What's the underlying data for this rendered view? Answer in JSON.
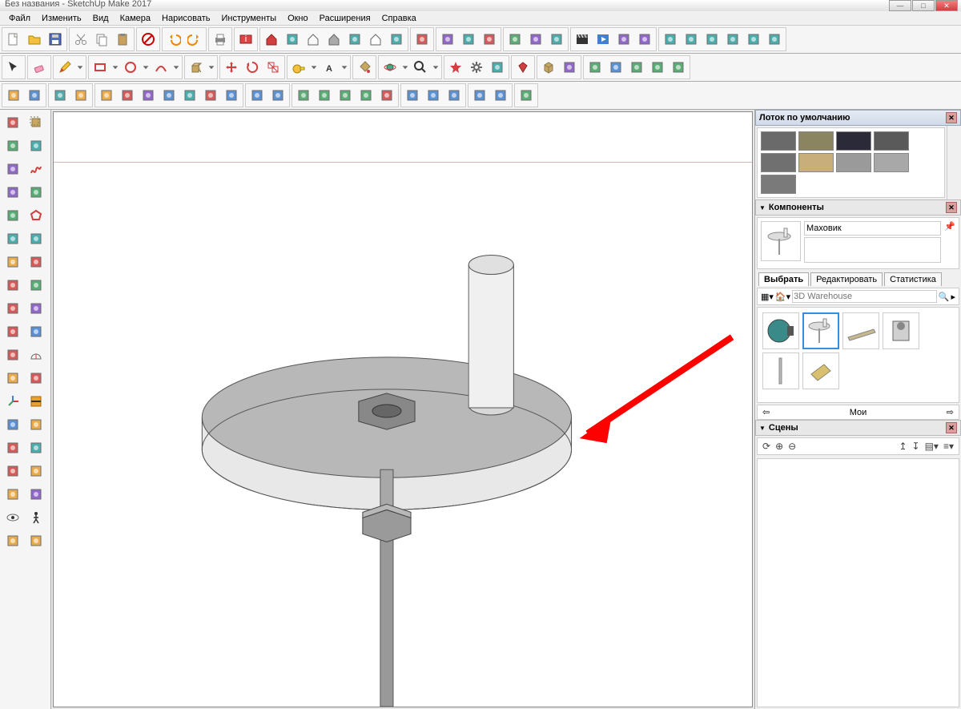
{
  "app": {
    "title": "Без названия - SketchUp Make 2017"
  },
  "menu": [
    "Файл",
    "Изменить",
    "Вид",
    "Камера",
    "Нарисовать",
    "Инструменты",
    "Окно",
    "Расширения",
    "Справка"
  ],
  "tray": {
    "title": "Лоток по умолчанию"
  },
  "materials_swatches": [
    "#6a6a6a",
    "#8a8560",
    "#2a2a38",
    "#5a5a5a",
    "#707070",
    "#c8ae7a",
    "#9a9a9a",
    "#a8a8a8",
    "#7a7a7a"
  ],
  "components": {
    "section": "Компоненты",
    "name": "Маховик",
    "tabs": [
      "Выбрать",
      "Редактировать",
      "Статистика"
    ],
    "active_tab": 0,
    "search_placeholder": "3D Warehouse",
    "nav_label": "Мои"
  },
  "scenes": {
    "section": "Сцены"
  },
  "icons_row1": [
    "new-file",
    "open-file",
    "save",
    "separator",
    "cut",
    "copy",
    "paste",
    "separator",
    "cancel",
    "separator",
    "undo",
    "redo",
    "separator",
    "print",
    "separator",
    "model-info",
    "separator",
    "house-red",
    "box-1",
    "house-outline",
    "house-gray",
    "box-2",
    "house-simple",
    "box-outline",
    "separator",
    "extension-gl",
    "separator",
    "red-plugin",
    "blue-plugin",
    "green-plugin",
    "separator",
    "book-red",
    "book-group",
    "panel",
    "separator",
    "clapperboard",
    "play",
    "timeline-a",
    "timeline-b",
    "separator",
    "doc-1",
    "doc-2",
    "doc-3",
    "doc-4",
    "doc-5",
    "doc-6"
  ],
  "icons_row2": [
    "select-arrow",
    "separator",
    "eraser",
    "separator",
    "pencil",
    "dropdown",
    "separator",
    "rectangle",
    "dropdown",
    "circle",
    "dropdown",
    "arc",
    "dropdown",
    "separator",
    "push-pull",
    "dropdown",
    "separator",
    "move",
    "rotate",
    "scale",
    "separator",
    "tape",
    "dropdown",
    "text",
    "dropdown",
    "separator",
    "paint-bucket",
    "separator",
    "orbit",
    "dropdown",
    "zoom",
    "dropdown",
    "separator",
    "star-tool",
    "gear",
    "stack",
    "separator",
    "ruby",
    "separator",
    "box-3d",
    "cone",
    "separator",
    "bar-blue",
    "bar-red",
    "arrows-1",
    "arrows-2",
    "arrows-3"
  ],
  "icons_row3": [
    "edge-tool",
    "vertical-tool",
    "separator",
    "cube-orange",
    "face-tool",
    "separator",
    "copy-cube",
    "sphere",
    "loft",
    "extrude",
    "sweep",
    "edge-2",
    "scale-2",
    "separator",
    "curve-1",
    "curve-2",
    "separator",
    "spiral-1",
    "spiral-2",
    "spiral-3",
    "spiral-4",
    "spring",
    "separator",
    "panel-a",
    "panel-b",
    "panel-c",
    "separator",
    "align-1",
    "align-2",
    "separator",
    "move-xyz"
  ],
  "left_tools": [
    "select",
    "component",
    "eraser-2",
    "paint",
    "line",
    "freehand",
    "rect",
    "rect-rot",
    "circle-2",
    "polygon",
    "arc-2",
    "arc-3",
    "pie",
    "bezier",
    "move-2",
    "rotate-2",
    "offset",
    "push",
    "follow",
    "scale-3",
    "tape-2",
    "protractor",
    "dimension",
    "text-2",
    "axes",
    "section",
    "orbit-2",
    "pan",
    "zoom-2",
    "zoom-window",
    "zoom-extents",
    "prev-view",
    "position-camera",
    "look",
    "eye",
    "walk",
    "sandbox-1",
    "sandbox-2"
  ]
}
